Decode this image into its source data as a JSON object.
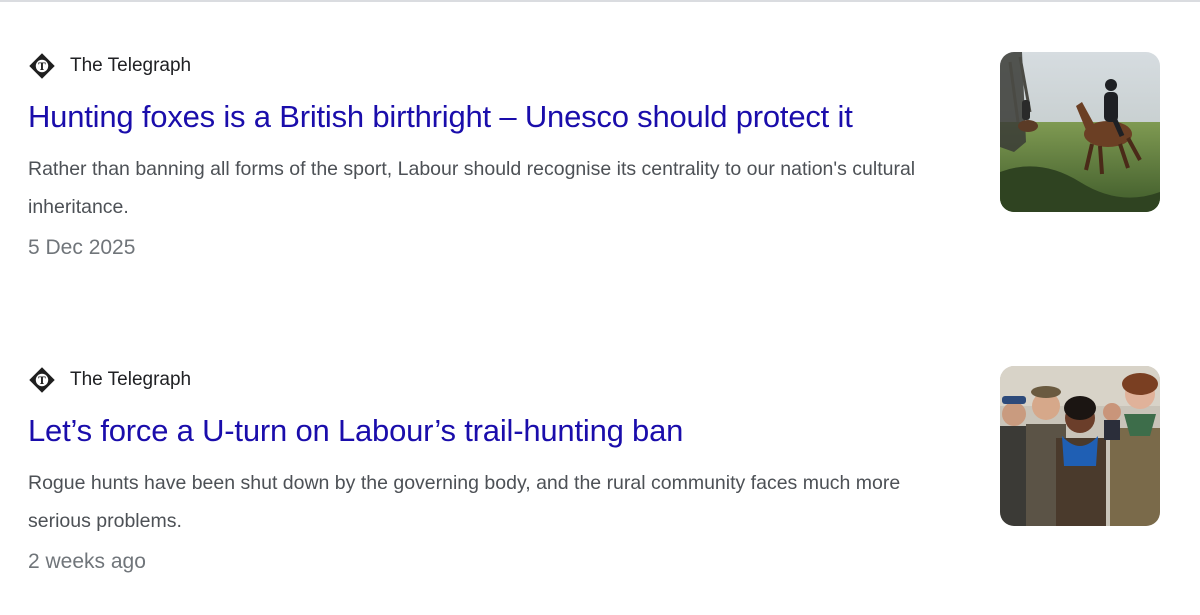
{
  "results": [
    {
      "source": {
        "name": "The Telegraph",
        "icon": "telegraph-logo-icon"
      },
      "headline": "Hunting foxes is a British birthright – Unesco should protect it",
      "snippet": "Rather than banning all forms of the sport, Labour should recognise its centrality to our nation's cultural inheritance.",
      "date": "5 Dec 2025",
      "thumbnail": "hunt-riders-thumbnail"
    },
    {
      "source": {
        "name": "The Telegraph",
        "icon": "telegraph-logo-icon"
      },
      "headline": "Let’s force a U-turn on Labour’s trail-hunting ban",
      "snippet": "Rogue hunts have been shut down by the governing body, and the rural community faces much more serious problems.",
      "date": "2 weeks ago",
      "thumbnail": "rural-crowd-thumbnail"
    }
  ],
  "colors": {
    "link": "#1a0dab",
    "snippet": "#4d5156",
    "date": "#70757a",
    "source": "#202124"
  }
}
